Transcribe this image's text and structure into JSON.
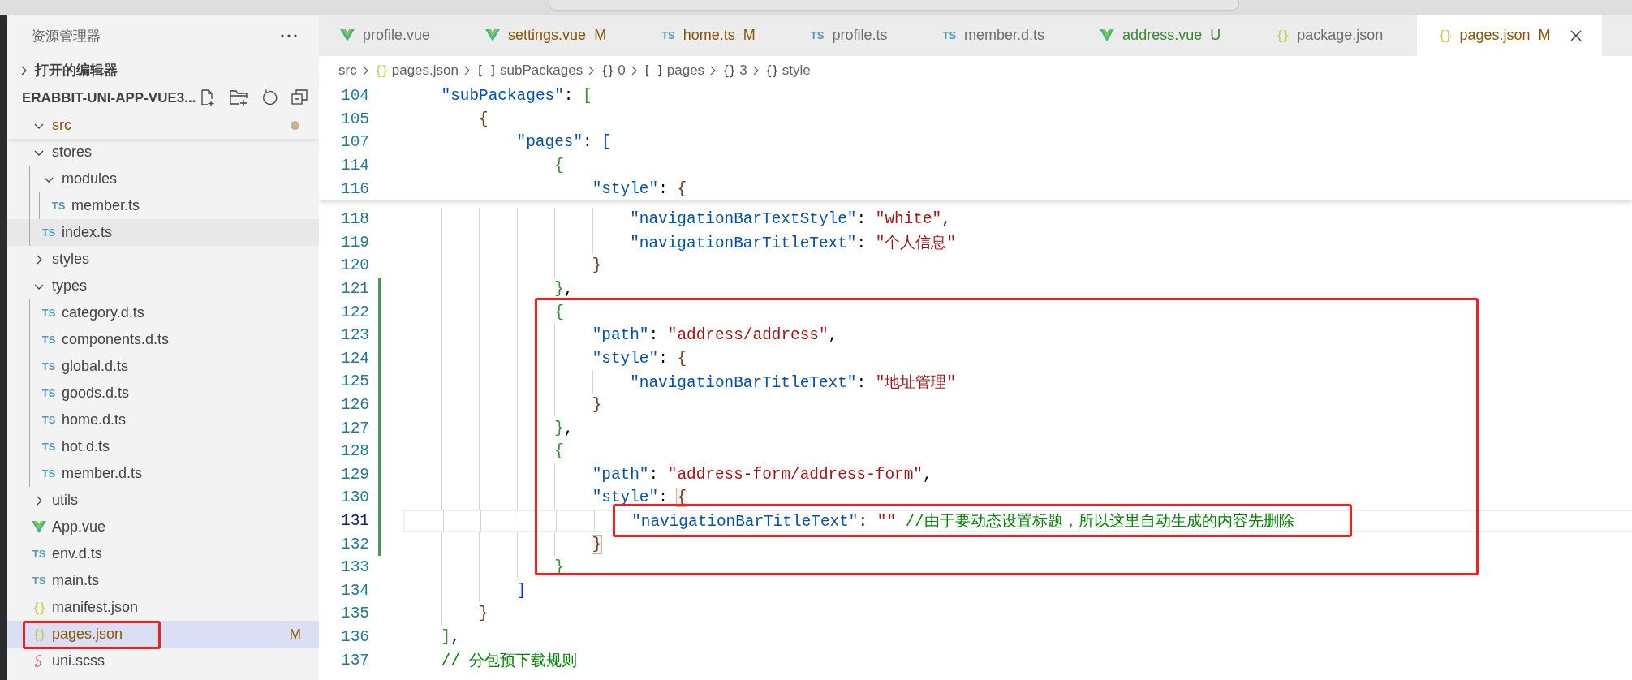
{
  "sidebar": {
    "title": "资源管理器",
    "sections": [
      {
        "label": "打开的编辑器",
        "expanded": false
      },
      {
        "label": "ERABBIT-UNI-APP-VUE3...",
        "expanded": true,
        "tree": [
          {
            "label": "src",
            "kind": "folder",
            "expanded": true,
            "modified": true,
            "children": [
              {
                "label": "stores",
                "kind": "folder",
                "expanded": true,
                "modified": false,
                "children": [
                  {
                    "label": "modules",
                    "kind": "folder",
                    "expanded": true,
                    "modified": false,
                    "children": [
                      {
                        "label": "member.ts",
                        "kind": "ts",
                        "icon_text": "TS",
                        "hovered": false,
                        "selected": false,
                        "modified": false
                      }
                    ]
                  },
                  {
                    "label": "index.ts",
                    "kind": "ts",
                    "icon_text": "TS",
                    "hovered": true,
                    "selected": false,
                    "modified": false
                  }
                ]
              },
              {
                "label": "styles",
                "kind": "folder",
                "expanded": false,
                "modified": false
              },
              {
                "label": "types",
                "kind": "folder",
                "expanded": true,
                "modified": false,
                "children": [
                  {
                    "label": "category.d.ts",
                    "kind": "ts",
                    "icon_text": "TS",
                    "hovered": false,
                    "selected": false,
                    "modified": false
                  },
                  {
                    "label": "components.d.ts",
                    "kind": "ts",
                    "icon_text": "TS",
                    "hovered": false,
                    "selected": false,
                    "modified": false
                  },
                  {
                    "label": "global.d.ts",
                    "kind": "ts",
                    "icon_text": "TS",
                    "hovered": false,
                    "selected": false,
                    "modified": false
                  },
                  {
                    "label": "goods.d.ts",
                    "kind": "ts",
                    "icon_text": "TS",
                    "hovered": false,
                    "selected": false,
                    "modified": false
                  },
                  {
                    "label": "home.d.ts",
                    "kind": "ts",
                    "icon_text": "TS",
                    "hovered": false,
                    "selected": false,
                    "modified": false
                  },
                  {
                    "label": "hot.d.ts",
                    "kind": "ts",
                    "icon_text": "TS",
                    "hovered": false,
                    "selected": false,
                    "modified": false
                  },
                  {
                    "label": "member.d.ts",
                    "kind": "ts",
                    "icon_text": "TS",
                    "hovered": false,
                    "selected": false,
                    "modified": false
                  }
                ]
              },
              {
                "label": "utils",
                "kind": "folder",
                "expanded": false,
                "modified": false
              },
              {
                "label": "App.vue",
                "kind": "vue",
                "hovered": false,
                "selected": false,
                "modified": false
              },
              {
                "label": "env.d.ts",
                "kind": "ts",
                "icon_text": "TS",
                "hovered": false,
                "selected": false,
                "modified": false
              },
              {
                "label": "main.ts",
                "kind": "ts",
                "icon_text": "TS",
                "hovered": false,
                "selected": false,
                "modified": false
              },
              {
                "label": "manifest.json",
                "kind": "json",
                "icon_text": "{}",
                "hovered": false,
                "selected": false,
                "modified": false
              },
              {
                "label": "pages.json",
                "kind": "json",
                "icon_text": "{}",
                "hovered": false,
                "selected": true,
                "modified": true,
                "badge": "M"
              },
              {
                "label": "uni.scss",
                "kind": "scss",
                "hovered": false,
                "selected": false,
                "modified": false
              }
            ]
          }
        ]
      }
    ]
  },
  "tabs": [
    {
      "label": "profile.vue",
      "kind": "vue",
      "modified": false,
      "untracked": false,
      "selected": false
    },
    {
      "label": "settings.vue",
      "kind": "vue",
      "badge": "M",
      "modified": true,
      "untracked": false,
      "selected": false
    },
    {
      "label": "home.ts",
      "kind": "ts",
      "icon_text": "TS",
      "badge": "M",
      "modified": true,
      "untracked": false,
      "selected": false
    },
    {
      "label": "profile.ts",
      "kind": "ts",
      "icon_text": "TS",
      "modified": false,
      "untracked": false,
      "selected": false
    },
    {
      "label": "member.d.ts",
      "kind": "ts",
      "icon_text": "TS",
      "modified": false,
      "untracked": false,
      "selected": false
    },
    {
      "label": "address.vue",
      "kind": "vue",
      "badge": "U",
      "modified": false,
      "untracked": true,
      "selected": false
    },
    {
      "label": "package.json",
      "kind": "json",
      "icon_text": "{}",
      "modified": false,
      "untracked": false,
      "selected": false
    },
    {
      "label": "pages.json",
      "kind": "json",
      "icon_text": "{}",
      "badge": "M",
      "modified": true,
      "untracked": false,
      "selected": true
    }
  ],
  "breadcrumb": [
    {
      "text": "src",
      "kind": "folder"
    },
    {
      "text": "pages.json",
      "kind": "json",
      "icon_text": "{}"
    },
    {
      "text": "subPackages",
      "kind": "array",
      "icon_text": "[ ]"
    },
    {
      "text": "0",
      "kind": "object",
      "icon_text": "{}"
    },
    {
      "text": "pages",
      "kind": "array",
      "icon_text": "[ ]"
    },
    {
      "text": "3",
      "kind": "object",
      "icon_text": "{}"
    },
    {
      "text": "style",
      "kind": "object",
      "icon_text": "{}"
    }
  ],
  "sticky_lines": [
    {
      "children": [
        {
          "number": "104",
          "tokens": [
            {
              "kind": "key",
              "text": "\"subPackages\""
            },
            {
              "kind": "punct",
              "text": ": "
            },
            {
              "kind": "bracket",
              "text": "[",
              "color": "#319331",
              "matched": false
            }
          ],
          "children": [
            {
              "number": "105",
              "tokens": [
                {
                  "kind": "bracket",
                  "text": "{",
                  "color": "#7b3814",
                  "matched": false
                }
              ],
              "children": [
                {
                  "number": "107",
                  "tokens": [
                    {
                      "kind": "key",
                      "text": "\"pages\""
                    },
                    {
                      "kind": "punct",
                      "text": ": "
                    },
                    {
                      "kind": "bracket",
                      "text": "[",
                      "color": "#0431fa",
                      "matched": false
                    }
                  ],
                  "children": [
                    {
                      "number": "114",
                      "tokens": [
                        {
                          "kind": "bracket",
                          "text": "{",
                          "color": "#319331",
                          "matched": false
                        }
                      ],
                      "children": [
                        {
                          "number": "116",
                          "tokens": [
                            {
                              "kind": "key",
                              "text": "\"style\""
                            },
                            {
                              "kind": "punct",
                              "text": ": "
                            },
                            {
                              "kind": "bracket",
                              "text": "{",
                              "color": "#7b3814",
                              "matched": false
                            }
                          ]
                        }
                      ]
                    }
                  ]
                }
              ]
            }
          ]
        }
      ]
    }
  ],
  "lines": [
    {
      "children": [
        {
          "children": [
            {
              "children": [
                {
                  "children": [
                    {
                      "children": [
                        {
                          "children": [
                            {
                              "number": "118",
                              "changed": false,
                              "current": false,
                              "tokens": [
                                {
                                  "kind": "key",
                                  "text": "\"navigationBarTextStyle\""
                                },
                                {
                                  "kind": "punct",
                                  "text": ": "
                                },
                                {
                                  "kind": "string",
                                  "text": "\"white\""
                                },
                                {
                                  "kind": "punct",
                                  "text": ","
                                }
                              ]
                            },
                            {
                              "number": "119",
                              "changed": false,
                              "current": false,
                              "tokens": [
                                {
                                  "kind": "key",
                                  "text": "\"navigationBarTitleText\""
                                },
                                {
                                  "kind": "punct",
                                  "text": ": "
                                },
                                {
                                  "kind": "string",
                                  "text": "\"个人信息\""
                                }
                              ]
                            }
                          ]
                        },
                        {
                          "number": "120",
                          "changed": false,
                          "current": false,
                          "tokens": [
                            {
                              "kind": "bracket",
                              "text": "}",
                              "color": "#7b3814",
                              "matched": false
                            }
                          ]
                        }
                      ]
                    },
                    {
                      "number": "121",
                      "changed": true,
                      "current": false,
                      "tokens": [
                        {
                          "kind": "bracket",
                          "text": "}",
                          "color": "#319331",
                          "matched": false
                        },
                        {
                          "kind": "punct",
                          "text": ","
                        }
                      ]
                    },
                    {
                      "number": "122",
                      "changed": true,
                      "current": false,
                      "tokens": [
                        {
                          "kind": "bracket",
                          "text": "{",
                          "color": "#319331",
                          "matched": false
                        }
                      ],
                      "children": [
                        {
                          "number": "123",
                          "changed": true,
                          "current": false,
                          "tokens": [
                            {
                              "kind": "key",
                              "text": "\"path\""
                            },
                            {
                              "kind": "punct",
                              "text": ": "
                            },
                            {
                              "kind": "string",
                              "text": "\"address/address\""
                            },
                            {
                              "kind": "punct",
                              "text": ","
                            }
                          ]
                        },
                        {
                          "number": "124",
                          "changed": true,
                          "current": false,
                          "tokens": [
                            {
                              "kind": "key",
                              "text": "\"style\""
                            },
                            {
                              "kind": "punct",
                              "text": ": "
                            },
                            {
                              "kind": "bracket",
                              "text": "{",
                              "color": "#7b3814",
                              "matched": false
                            }
                          ],
                          "children": [
                            {
                              "number": "125",
                              "changed": true,
                              "current": false,
                              "tokens": [
                                {
                                  "kind": "key",
                                  "text": "\"navigationBarTitleText\""
                                },
                                {
                                  "kind": "punct",
                                  "text": ": "
                                },
                                {
                                  "kind": "string",
                                  "text": "\"地址管理\""
                                }
                              ]
                            }
                          ]
                        },
                        {
                          "number": "126",
                          "changed": true,
                          "current": false,
                          "tokens": [
                            {
                              "kind": "bracket",
                              "text": "}",
                              "color": "#7b3814",
                              "matched": false
                            }
                          ]
                        }
                      ]
                    },
                    {
                      "number": "127",
                      "changed": true,
                      "current": false,
                      "tokens": [
                        {
                          "kind": "bracket",
                          "text": "}",
                          "color": "#319331",
                          "matched": false
                        },
                        {
                          "kind": "punct",
                          "text": ","
                        }
                      ]
                    },
                    {
                      "number": "128",
                      "changed": true,
                      "current": false,
                      "tokens": [
                        {
                          "kind": "bracket",
                          "text": "{",
                          "color": "#319331",
                          "matched": false
                        }
                      ],
                      "children": [
                        {
                          "number": "129",
                          "changed": true,
                          "current": false,
                          "tokens": [
                            {
                              "kind": "key",
                              "text": "\"path\""
                            },
                            {
                              "kind": "punct",
                              "text": ": "
                            },
                            {
                              "kind": "string",
                              "text": "\"address-form/address-form\""
                            },
                            {
                              "kind": "punct",
                              "text": ","
                            }
                          ]
                        },
                        {
                          "number": "130",
                          "changed": true,
                          "current": false,
                          "tokens": [
                            {
                              "kind": "key",
                              "text": "\"style\""
                            },
                            {
                              "kind": "punct",
                              "text": ": "
                            },
                            {
                              "kind": "bracket",
                              "text": "{",
                              "color": "#7b3814",
                              "matched": true
                            }
                          ],
                          "children": [
                            {
                              "number": "131",
                              "changed": true,
                              "current": true,
                              "tokens": [
                                {
                                  "kind": "key",
                                  "text": "\"navigationBarTitleText\""
                                },
                                {
                                  "kind": "punct",
                                  "text": ": "
                                },
                                {
                                  "kind": "string",
                                  "text": "\"\""
                                },
                                {
                                  "kind": "comment",
                                  "text": " //由于要动态设置标题，所以这里自动生成的内容先删除"
                                }
                              ]
                            }
                          ]
                        },
                        {
                          "number": "132",
                          "changed": true,
                          "current": false,
                          "tokens": [
                            {
                              "kind": "bracket",
                              "text": "}",
                              "color": "#7b3814",
                              "matched": true
                            }
                          ]
                        }
                      ]
                    },
                    {
                      "number": "133",
                      "changed": false,
                      "current": false,
                      "tokens": [
                        {
                          "kind": "bracket",
                          "text": "}",
                          "color": "#319331",
                          "matched": false
                        }
                      ]
                    }
                  ]
                },
                {
                  "number": "134",
                  "changed": false,
                  "current": false,
                  "tokens": [
                    {
                      "kind": "bracket",
                      "text": "]",
                      "color": "#0431fa",
                      "matched": false
                    }
                  ]
                }
              ]
            },
            {
              "number": "135",
              "changed": false,
              "current": false,
              "tokens": [
                {
                  "kind": "bracket",
                  "text": "}",
                  "color": "#7b3814",
                  "matched": false
                }
              ]
            }
          ]
        },
        {
          "number": "136",
          "changed": false,
          "current": false,
          "tokens": [
            {
              "kind": "bracket",
              "text": "]",
              "color": "#319331",
              "matched": false
            },
            {
              "kind": "punct",
              "text": ","
            }
          ]
        },
        {
          "number": "137",
          "changed": false,
          "current": false,
          "tokens": [
            {
              "kind": "comment",
              "text": "// 分包预下载规则"
            }
          ]
        }
      ]
    }
  ]
}
